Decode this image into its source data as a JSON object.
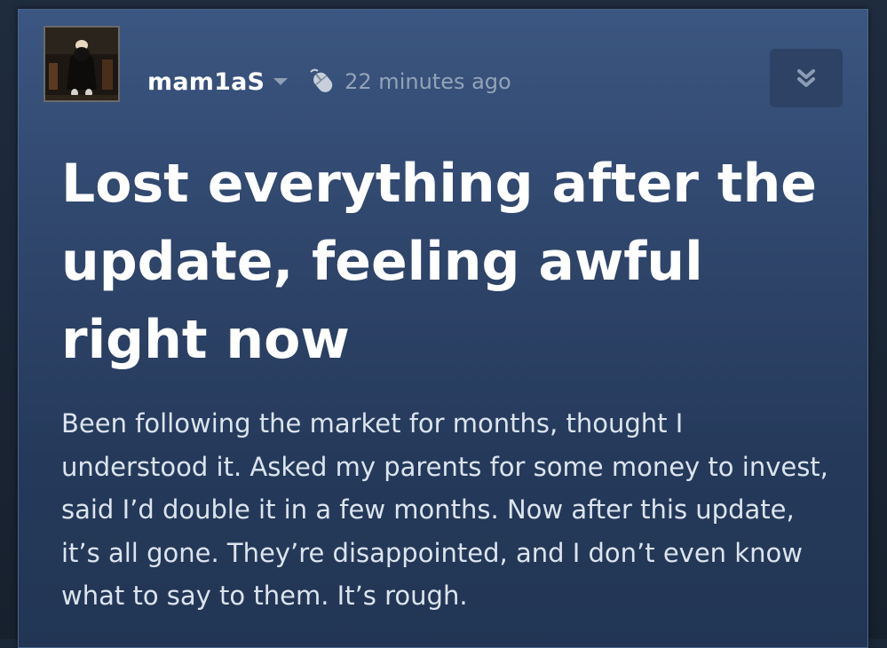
{
  "post": {
    "author": "mam1aS",
    "timestamp": "22 minutes ago",
    "title": "Lost everything after the update, feeling awful right now",
    "body": "Been following the market for months, thought I understood it. Asked my parents for some money to invest, said I’d double it in a few months. Now after this update, it’s all gone. They’re disappointed, and I don’t even know what to say to them. It’s rough."
  },
  "icons": {
    "author_menu": "chevron-down-icon",
    "platform": "mouse-icon",
    "collapse": "double-chevron-down-icon"
  },
  "colors": {
    "card_top": "#3b5681",
    "card_bottom": "#223554",
    "title": "#ffffff",
    "body_text": "#dce4ee",
    "muted": "#93a3b8",
    "button_bg": "#2d4264"
  }
}
